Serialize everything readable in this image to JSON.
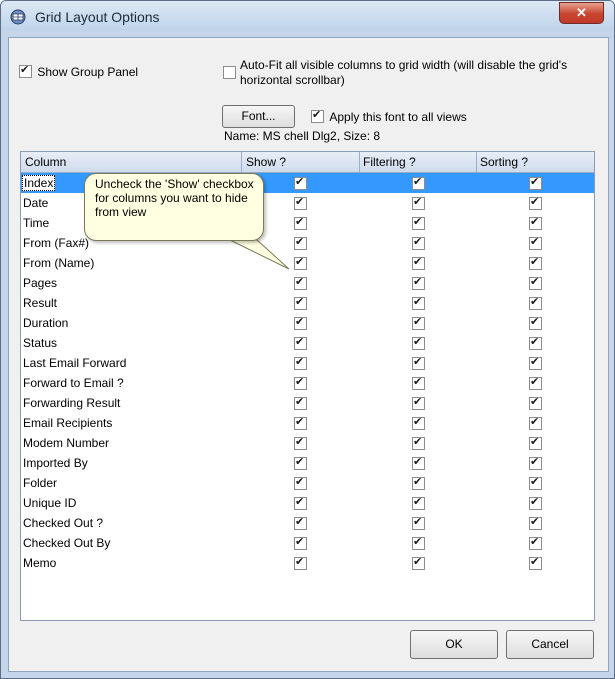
{
  "window": {
    "title": "Grid Layout Options",
    "close_glyph": "✕"
  },
  "options": {
    "show_group_panel": {
      "label": "Show Group Panel",
      "checked": true
    },
    "autofit": {
      "line1": "Auto-Fit all visible columns to grid width (will disable the grid's",
      "line2": "horizontal scrollbar)",
      "checked": false
    },
    "font_button": "Font...",
    "apply_font": {
      "label": "Apply this font to all views",
      "checked": true
    },
    "font_name": "Name: MS chell Dlg2, Size: 8"
  },
  "grid": {
    "headers": {
      "column": "Column",
      "show": "Show ?",
      "filtering": "Filtering ?",
      "sorting": "Sorting ?"
    },
    "rows": [
      {
        "name": "Index",
        "show": true,
        "filtering": true,
        "sorting": true
      },
      {
        "name": "Date",
        "show": true,
        "filtering": true,
        "sorting": true
      },
      {
        "name": "Time",
        "show": true,
        "filtering": true,
        "sorting": true
      },
      {
        "name": "From (Fax#)",
        "show": true,
        "filtering": true,
        "sorting": true
      },
      {
        "name": "From (Name)",
        "show": true,
        "filtering": true,
        "sorting": true
      },
      {
        "name": "Pages",
        "show": true,
        "filtering": true,
        "sorting": true
      },
      {
        "name": "Result",
        "show": true,
        "filtering": true,
        "sorting": true
      },
      {
        "name": "Duration",
        "show": true,
        "filtering": true,
        "sorting": true
      },
      {
        "name": "Status",
        "show": true,
        "filtering": true,
        "sorting": true
      },
      {
        "name": "Last Email Forward",
        "show": true,
        "filtering": true,
        "sorting": true
      },
      {
        "name": "Forward to Email ?",
        "show": true,
        "filtering": true,
        "sorting": true
      },
      {
        "name": "Forwarding Result",
        "show": true,
        "filtering": true,
        "sorting": true
      },
      {
        "name": "Email Recipients",
        "show": true,
        "filtering": true,
        "sorting": true
      },
      {
        "name": "Modem Number",
        "show": true,
        "filtering": true,
        "sorting": true
      },
      {
        "name": "Imported By",
        "show": true,
        "filtering": true,
        "sorting": true
      },
      {
        "name": "Folder",
        "show": true,
        "filtering": true,
        "sorting": true
      },
      {
        "name": "Unique ID",
        "show": true,
        "filtering": true,
        "sorting": true
      },
      {
        "name": "Checked Out ?",
        "show": true,
        "filtering": true,
        "sorting": true
      },
      {
        "name": "Checked Out By",
        "show": true,
        "filtering": true,
        "sorting": true
      },
      {
        "name": "Memo",
        "show": true,
        "filtering": true,
        "sorting": true
      }
    ],
    "selected_row": "Index"
  },
  "tooltip": {
    "text": "Uncheck the 'Show' checkbox for columns you want to hide from view"
  },
  "buttons": {
    "ok": "OK",
    "cancel": "Cancel"
  },
  "colors": {
    "selection": "#3399ff",
    "tooltip_bg": "#ffffe1"
  }
}
